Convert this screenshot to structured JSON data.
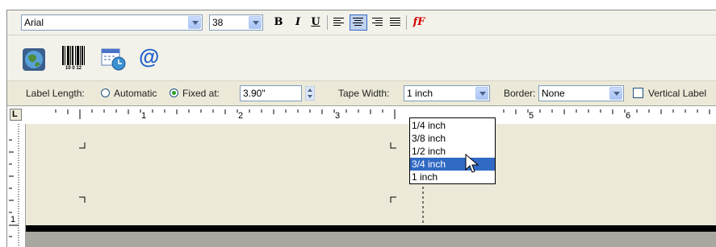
{
  "toolbar_font": {
    "font_name": "Arial",
    "font_size": "38",
    "bold": "B",
    "italic": "I",
    "underline": "U",
    "fx_label": "fF"
  },
  "toolbar_insert": {
    "icons": [
      "globe-icon",
      "barcode-icon",
      "date-time-icon",
      "email-at-icon"
    ],
    "barcode_caption": "10 0 12",
    "at_symbol": "@"
  },
  "toolbar_label": {
    "label_length_text": "Label Length:",
    "automatic_text": "Automatic",
    "fixed_at_text": "Fixed at:",
    "fixed_at_value": "3.90\"",
    "length_mode": "Fixed at",
    "tape_width_text": "Tape Width:",
    "tape_width_value": "1 inch",
    "border_text": "Border:",
    "border_value": "None",
    "vertical_label_text": "Vertical Label",
    "vertical_checked": false
  },
  "ruler": {
    "numbers": [
      "1",
      "2",
      "3",
      "5",
      "6"
    ],
    "tab_stop": "L",
    "side_number": "1"
  },
  "tape_width_dropdown": {
    "options": [
      "1/4 inch",
      "3/8 inch",
      "1/2 inch",
      "3/4 inch",
      "1 inch"
    ],
    "highlighted": "3/4 inch"
  },
  "colors": {
    "selection": "#316ac5",
    "toolbar": "#ece9d8",
    "fx_color": "#d40000"
  }
}
